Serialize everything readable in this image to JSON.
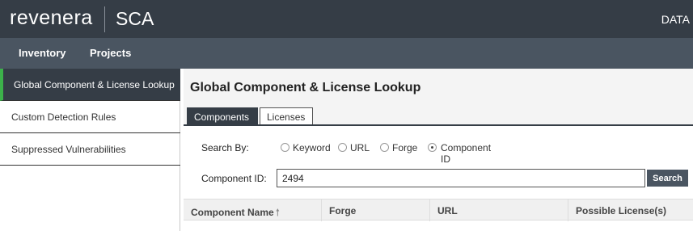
{
  "header": {
    "brand": "revenera",
    "product": "SCA",
    "right_text": "DATA"
  },
  "nav": {
    "items": [
      "Inventory",
      "Projects"
    ]
  },
  "sidebar": {
    "items": [
      {
        "label": "Global Component & License Lookup",
        "active": true
      },
      {
        "label": "Custom Detection Rules",
        "active": false
      },
      {
        "label": "Suppressed Vulnerabilities",
        "active": false
      }
    ]
  },
  "main": {
    "title": "Global Component & License Lookup",
    "tabs": [
      {
        "label": "Components",
        "active": true
      },
      {
        "label": "Licenses",
        "active": false
      }
    ],
    "search": {
      "by_label": "Search By:",
      "options": [
        {
          "label": "Keyword",
          "checked": false
        },
        {
          "label": "URL",
          "checked": false
        },
        {
          "label": "Forge",
          "checked": false
        },
        {
          "label": "Component ID",
          "checked": true
        }
      ],
      "field_label": "Component ID:",
      "field_value": "2494",
      "button_label": "Search"
    },
    "table": {
      "columns": [
        "Component Name",
        "Forge",
        "URL",
        "Possible License(s)"
      ],
      "sort_icon": "arrow-up-icon"
    }
  },
  "colors": {
    "header_bg": "#353d46",
    "nav_bg": "#4a5561",
    "accent": "#3cb14a"
  }
}
